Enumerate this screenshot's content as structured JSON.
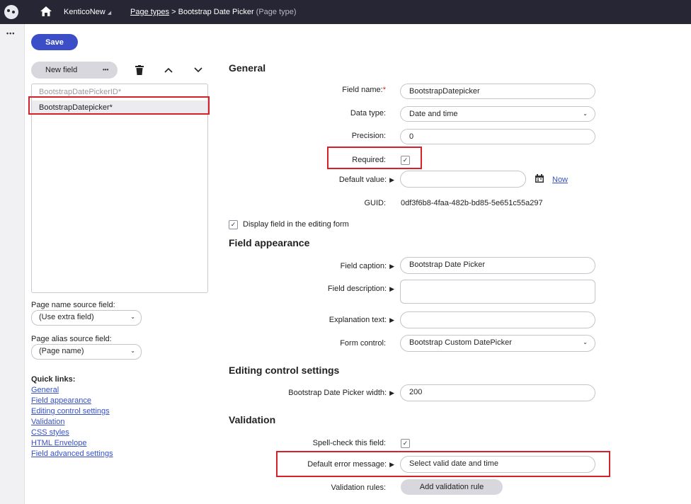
{
  "topbar": {
    "logo_icon": "kentico-logo-icon",
    "home_icon": "home-icon",
    "site_name": "KenticoNew",
    "site_arrow": "◢",
    "crumb_page_types": "Page types",
    "crumb_separator": ">",
    "crumb_current": "Bootstrap Date Picker",
    "crumb_current_suffix": "(Page type)"
  },
  "left_strip": {
    "menu_dots": "•••"
  },
  "panel": {
    "save_label": "Save",
    "new_field_label": "New field",
    "new_field_more": "•••",
    "fields": [
      {
        "name": "BootstrapDatePickerID*"
      },
      {
        "name": "BootstrapDatepicker*"
      }
    ],
    "page_name_source_label": "Page name source field:",
    "page_name_source_value": "(Use extra field)",
    "page_alias_source_label": "Page alias source field:",
    "page_alias_source_value": "(Page name)",
    "quick_links_title": "Quick links:",
    "quick_links": [
      "General",
      "Field appearance",
      "Editing control settings",
      "Validation",
      "CSS styles",
      "HTML Envelope",
      "Field advanced settings"
    ]
  },
  "general": {
    "heading": "General",
    "field_name_label": "Field name:",
    "field_name_req": "*",
    "field_name_value": "BootstrapDatepicker",
    "data_type_label": "Data type:",
    "data_type_value": "Date and time",
    "precision_label": "Precision:",
    "precision_value": "0",
    "required_label": "Required:",
    "default_value_label": "Default value:",
    "default_value_value": "",
    "now_label": "Now",
    "guid_label": "GUID:",
    "guid_value": "0df3f6b8-4faa-482b-bd85-5e651c55a297",
    "display_field_label": "Display field in the editing form"
  },
  "appearance": {
    "heading": "Field appearance",
    "caption_label": "Field caption:",
    "caption_value": "Bootstrap Date Picker",
    "description_label": "Field description:",
    "explanation_label": "Explanation text:",
    "form_control_label": "Form control:",
    "form_control_value": "Bootstrap Custom DatePicker"
  },
  "editing": {
    "heading": "Editing control settings",
    "width_label": "Bootstrap Date Picker width:",
    "width_value": "200"
  },
  "validation": {
    "heading": "Validation",
    "spell_check_label": "Spell-check this field:",
    "default_error_label": "Default error message:",
    "default_error_value": "Select valid date and time",
    "rules_label": "Validation rules:",
    "add_rule_label": "Add validation rule"
  },
  "checkmark": "✓",
  "expand_arrow": "▶",
  "chevron": "⌄"
}
